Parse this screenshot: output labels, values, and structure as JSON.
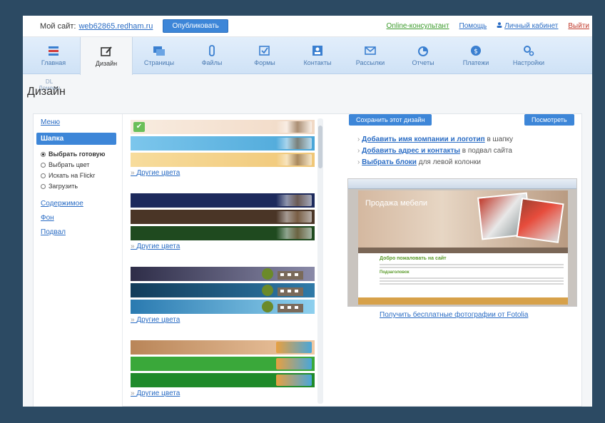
{
  "topbar": {
    "site_label": "Мой сайт:",
    "site_link": "web62865.redham.ru",
    "publish": "Опубликовать",
    "online": "Online-консультант",
    "help": "Помощь",
    "cabinet": "Личный кабинет",
    "logout": "Выйти"
  },
  "nav": {
    "items": [
      {
        "label": "Главная",
        "icon": "home-icon"
      },
      {
        "label": "Дизайн",
        "icon": "design-icon"
      },
      {
        "label": "Страницы",
        "icon": "pages-icon"
      },
      {
        "label": "Файлы",
        "icon": "files-icon"
      },
      {
        "label": "Формы",
        "icon": "forms-icon"
      },
      {
        "label": "Контакты",
        "icon": "contacts-icon"
      },
      {
        "label": "Рассылки",
        "icon": "mail-icon"
      },
      {
        "label": "Отчеты",
        "icon": "reports-icon"
      },
      {
        "label": "Платежи",
        "icon": "payments-icon"
      },
      {
        "label": "Настройки",
        "icon": "settings-icon"
      }
    ],
    "active": "Дизайн"
  },
  "domains": {
    "code": "DL",
    "label": "Домены"
  },
  "page_title": "Дизайн",
  "left_menu": {
    "menu": "Меню",
    "header": "Шапка",
    "options": [
      "Выбрать готовую",
      "Выбрать цвет",
      "Искать на Flickr",
      "Загрузить"
    ],
    "selected_option": "Выбрать готовую",
    "content": "Содержимое",
    "background": "Фон",
    "footer": "Подвал"
  },
  "themes": {
    "more_colors": "Другие цвета",
    "groups": [
      {
        "colors": [
          "#f1d9c5",
          "#4aa6d8",
          "#f0c777"
        ]
      },
      {
        "colors": [
          "#1d2a5c",
          "#4a3526",
          "#1f4a1f"
        ]
      },
      {
        "colors": [
          "#4b4a6b",
          "#1c5a80",
          "#2f8ab8"
        ]
      },
      {
        "colors": [
          "#d9a77e",
          "#3aa83a",
          "#1f8a2a"
        ]
      }
    ]
  },
  "right": {
    "save": "Сохранить этот дизайн",
    "preview": "Посмотреть",
    "tip1_link": "Добавить имя компании и логотип",
    "tip1_rest": " в шапку",
    "tip2_link": "Добавить адрес и контакты",
    "tip2_rest": " в подвал сайта",
    "tip3_link": "Выбрать блоки",
    "tip3_rest": " для левой колонки",
    "shot_title": "Продажа мебели",
    "shot_heading": "Добро пожаловать на сайт",
    "shot_subheading": "Подзаголовок",
    "fotolia": "Получить бесплатные фотографии от Fotolia"
  }
}
